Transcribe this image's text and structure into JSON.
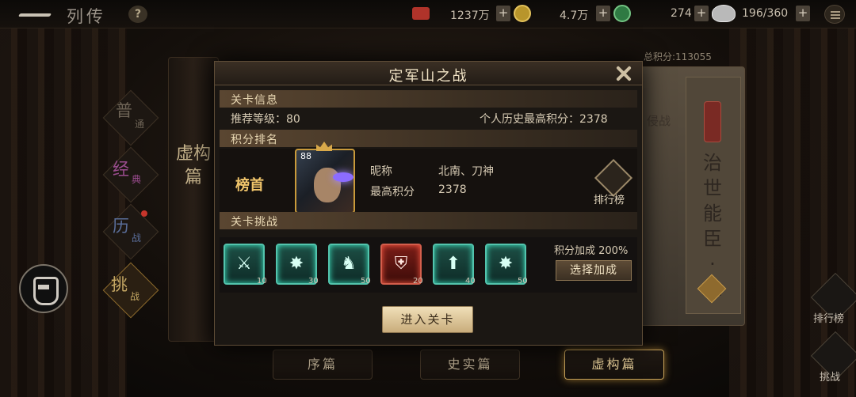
{
  "topbar": {
    "title": "列传",
    "help": "?",
    "resources": [
      {
        "value": "1237万",
        "icon": "scroll-icon"
      },
      {
        "value": "4.7万",
        "icon": "jade-icon"
      },
      {
        "value": "274",
        "icon": "silver-ingot-icon"
      },
      {
        "value": "196/360",
        "icon": "stamina-icon"
      }
    ],
    "plus": "+"
  },
  "side": {
    "scroll_title": "虚构篇",
    "modes": [
      {
        "main": "普",
        "sub": "通"
      },
      {
        "main": "经",
        "sub": "典"
      },
      {
        "main": "历",
        "sub": "战"
      },
      {
        "main": "挑",
        "sub": "战"
      }
    ]
  },
  "right": {
    "total_score": "总积分:113055",
    "card_title": "治世能臣·二",
    "card_small": "侵战",
    "leaderboard_label": "排行榜",
    "challenge_label": "挑战"
  },
  "bottom_tabs": [
    "序篇",
    "史实篇",
    "虚构篇"
  ],
  "active_tab": 2,
  "dialog": {
    "title": "定军山之战",
    "stage_info": {
      "header": "关卡信息",
      "recommended_label": "推荐等级：",
      "recommended_value": "80",
      "best_label": "个人历史最高积分：",
      "best_value": "2378"
    },
    "ranking": {
      "header": "积分排名",
      "rank_label": "榜首",
      "avatar_level": "88",
      "nickname_label": "昵称",
      "nickname_value": "北南、刀神",
      "score_label": "最高积分",
      "score_value": "2378",
      "leaderboard_button": "排行榜"
    },
    "challenge": {
      "header": "关卡挑战",
      "items": [
        {
          "icon": "crossed-swords-icon",
          "glyph": "⚔",
          "count": "10",
          "color": "green"
        },
        {
          "icon": "burst-icon",
          "glyph": "✸",
          "count": "30",
          "color": "green"
        },
        {
          "icon": "warrior-icon",
          "glyph": "♞",
          "count": "50",
          "color": "green"
        },
        {
          "icon": "shield-icon",
          "glyph": "⛨",
          "count": "20",
          "color": "red"
        },
        {
          "icon": "arrow-up-icon",
          "glyph": "⬆",
          "count": "40",
          "color": "green"
        },
        {
          "icon": "burst-icon",
          "glyph": "✸",
          "count": "50",
          "color": "green"
        }
      ],
      "bonus_label": "积分加成 200%",
      "bonus_button": "选择加成"
    },
    "enter_button": "进入关卡"
  }
}
